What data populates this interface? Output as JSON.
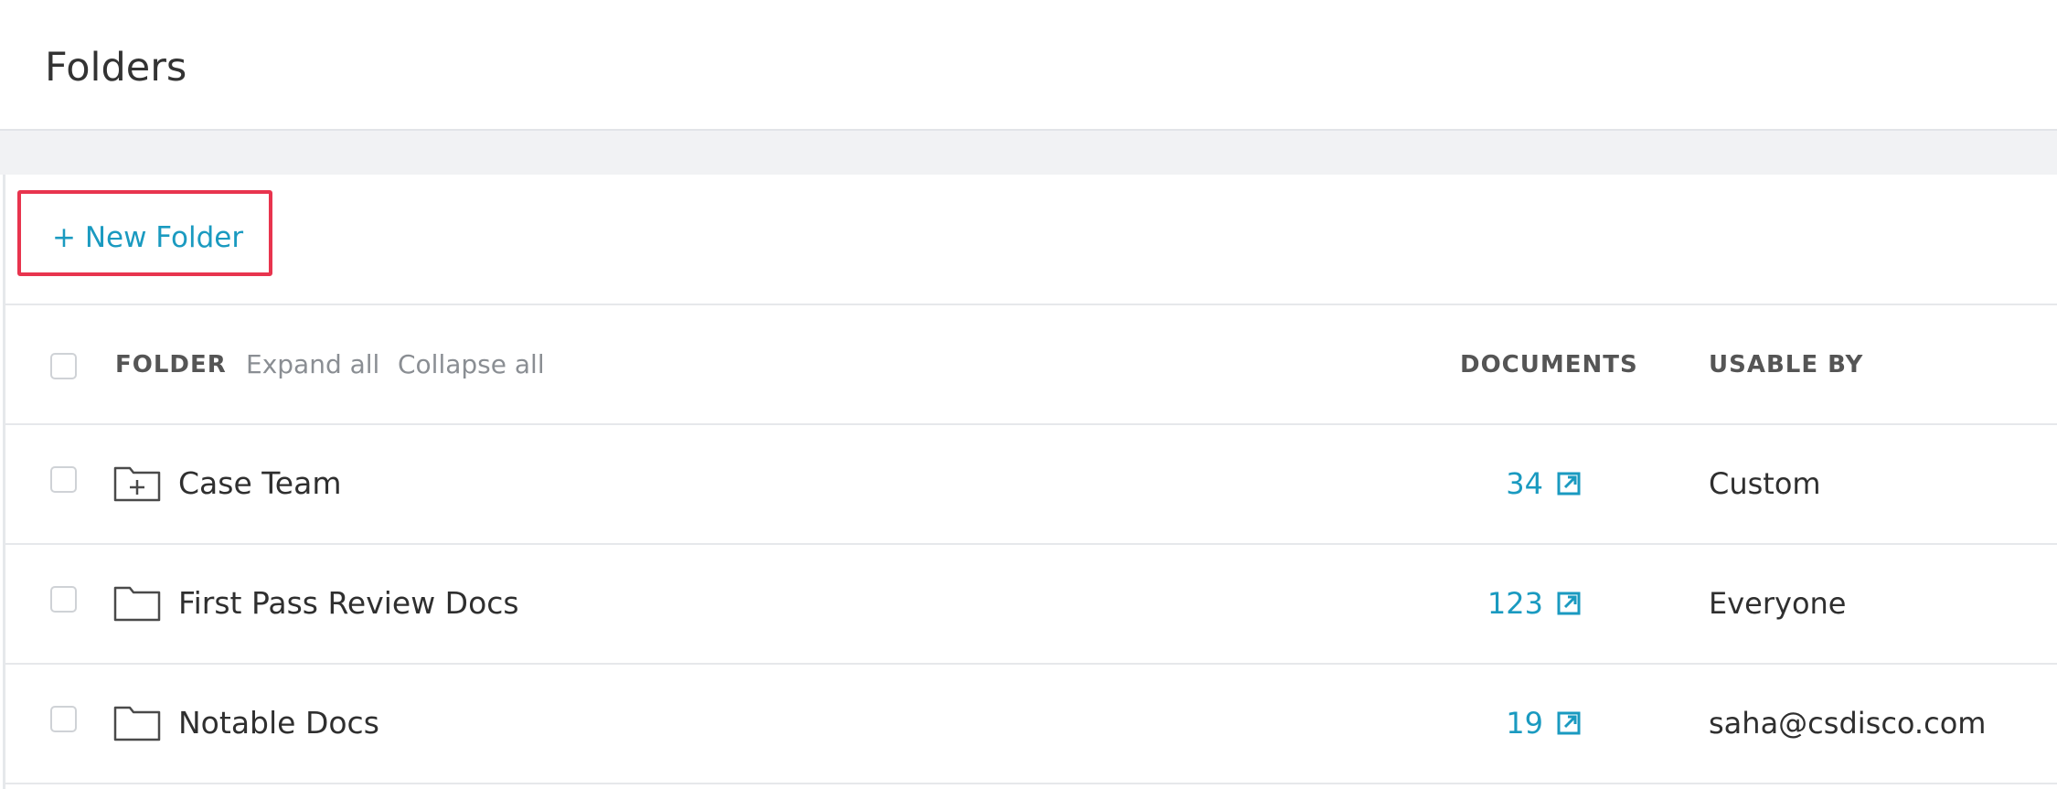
{
  "page": {
    "title": "Folders"
  },
  "toolbar": {
    "new_folder_label": "+ New Folder"
  },
  "table": {
    "columns": {
      "folder": "FOLDER",
      "expand_all": "Expand all",
      "collapse_all": "Collapse all",
      "documents": "DOCUMENTS",
      "usable_by": "USABLE BY"
    },
    "rows": [
      {
        "name": "Case Team",
        "documents": "34",
        "usable_by": "Custom",
        "icon": "folder-plus-icon"
      },
      {
        "name": "First Pass Review Docs",
        "documents": "123",
        "usable_by": "Everyone",
        "icon": "folder-icon"
      },
      {
        "name": "Notable Docs",
        "documents": "19",
        "usable_by": "saha@csdisco.com",
        "icon": "folder-icon"
      }
    ]
  },
  "colors": {
    "link": "#1a9ac0",
    "highlight_border": "#e8344e",
    "band": "#f1f2f4",
    "divider": "#e6e8eb"
  }
}
